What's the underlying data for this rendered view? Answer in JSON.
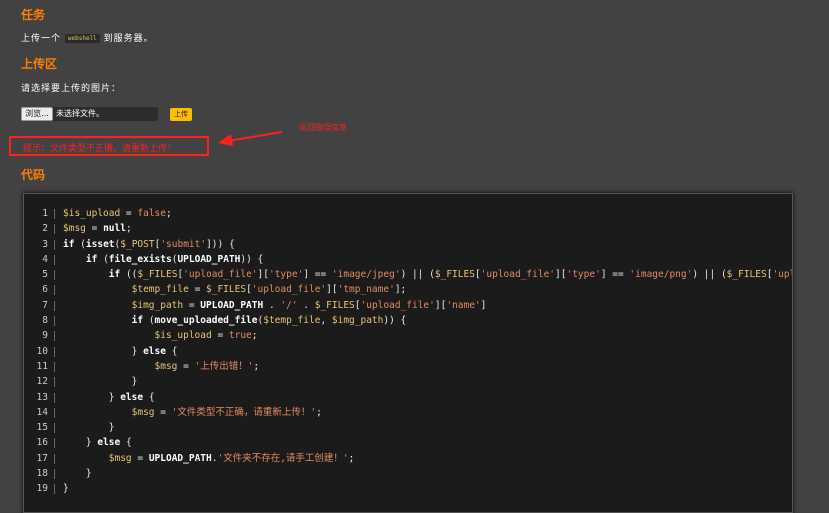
{
  "task": {
    "heading": "任务",
    "text_before": "上传一个",
    "inline_code": "webshell",
    "text_after": "到服务器。"
  },
  "upload_area": {
    "heading": "上传区",
    "prompt": "请选择要上传的图片：",
    "browse_label": "浏览...",
    "file_status": "未选择文件。",
    "upload_label": "上传"
  },
  "tip": {
    "text": "提示：文件类型不正确，请重新上传！"
  },
  "annotation": {
    "text": "返回错误信息"
  },
  "code_section": {
    "heading": "代码",
    "lines": [
      "1",
      "2",
      "3",
      "4",
      "5",
      "6",
      "7",
      "8",
      "9",
      "10",
      "11",
      "12",
      "13",
      "14",
      "15",
      "16",
      "17",
      "18",
      "19"
    ]
  },
  "colors": {
    "background": "#424242",
    "heading": "#ff7e00",
    "button": "#ffbf00",
    "error": "#ff2020",
    "code_bg": "#1b1b1b"
  }
}
